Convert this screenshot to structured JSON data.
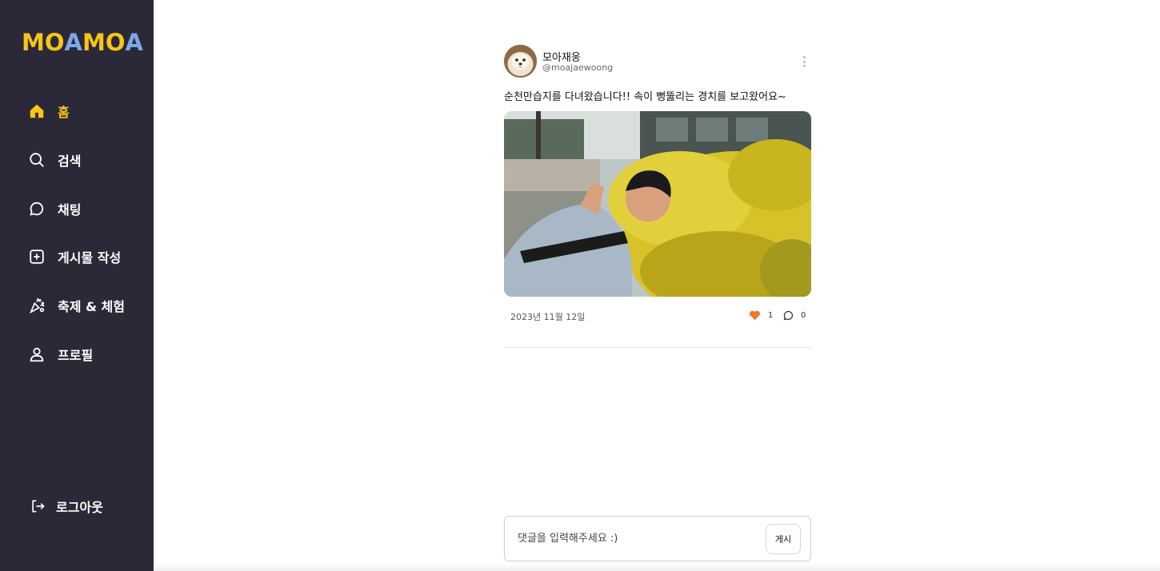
{
  "app": {
    "logo_parts": [
      {
        "text": "MO",
        "color": "#f5c518"
      },
      {
        "text": "A",
        "color": "#7da7e8"
      },
      {
        "text": "MO",
        "color": "#f5c518"
      },
      {
        "text": "A",
        "color": "#7da7e8"
      }
    ]
  },
  "sidebar": {
    "items": [
      {
        "label": "홈",
        "icon": "home-icon",
        "active": true
      },
      {
        "label": "검색",
        "icon": "search-icon",
        "active": false
      },
      {
        "label": "채팅",
        "icon": "chat-icon",
        "active": false
      },
      {
        "label": "게시물 작성",
        "icon": "plus-square-icon",
        "active": false
      },
      {
        "label": "축제 & 체험",
        "icon": "festival-icon",
        "active": false
      },
      {
        "label": "프로필",
        "icon": "user-icon",
        "active": false
      }
    ],
    "logout_label": "로그아웃"
  },
  "post": {
    "author_name": "모아재웅",
    "author_handle": "@moajaewoong",
    "text": "순천만습지를 다녀왔습니다!! 속이 뻥뚫리는 경치를 보고왔어요~",
    "date": "2023년 11월 12일",
    "like_count": "1",
    "comment_count": "0",
    "liked": true
  },
  "comment_form": {
    "placeholder": "댓글을 입력해주세요 :)",
    "submit_label": "게시"
  },
  "colors": {
    "sidebar_bg": "#2b2838",
    "accent": "#f5c518",
    "like": "#f07a2a"
  }
}
